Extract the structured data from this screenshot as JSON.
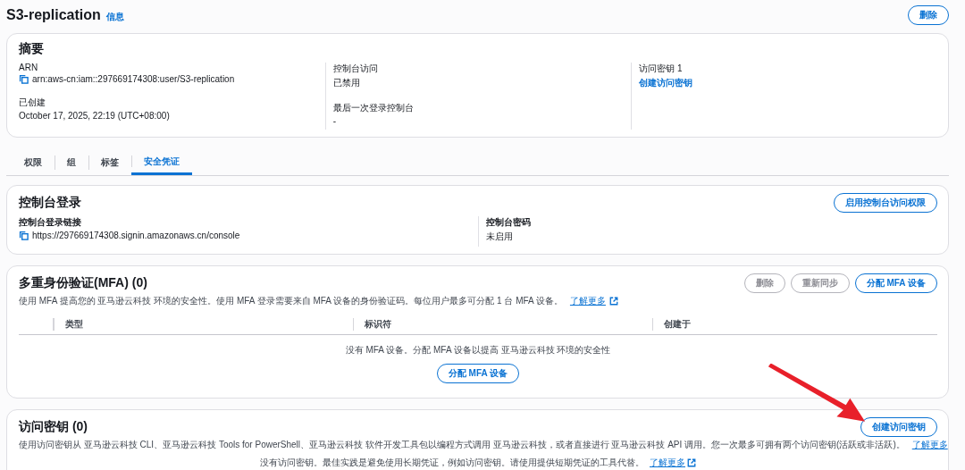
{
  "page": {
    "title": "S3-replication",
    "info_link": "信息",
    "delete_button": "删除"
  },
  "summary": {
    "title": "摘要",
    "columns": [
      [
        {
          "label": "ARN",
          "value": "arn:aws-cn:iam::297669174308:user/S3-replication",
          "kind": "copy"
        },
        {
          "label": "已创建",
          "value": "October 17, 2025, 22:19 (UTC+08:00)",
          "kind": "text"
        }
      ],
      [
        {
          "label": "控制台访问",
          "value": "已禁用",
          "kind": "text"
        },
        {
          "label": "最后一次登录控制台",
          "value": "-",
          "kind": "text"
        }
      ],
      [
        {
          "label": "访问密钥 1",
          "value": "创建访问密钥",
          "kind": "link"
        }
      ]
    ]
  },
  "tabs": [
    {
      "label": "权限",
      "selected": false
    },
    {
      "label": "组",
      "selected": false
    },
    {
      "label": "标签",
      "selected": false
    },
    {
      "label": "安全凭证",
      "selected": true
    }
  ],
  "console_login": {
    "title": "控制台登录",
    "button": "启用控制台访问权限",
    "fields": [
      {
        "label": "控制台登录链接",
        "value": "https://297669174308.signin.amazonaws.cn/console",
        "kind": "copy"
      },
      {
        "label": "控制台密码",
        "value": "未启用",
        "kind": "text"
      }
    ]
  },
  "mfa": {
    "title": "多重身份验证(MFA) (0)",
    "description": "使用 MFA 提高您的 亚马逊云科技 环境的安全性。使用 MFA 登录需要来自 MFA 设备的身份验证码。每位用户最多可分配 1 台 MFA 设备。",
    "learn_more": "了解更多",
    "buttons": [
      {
        "label": "删除",
        "disabled": true
      },
      {
        "label": "重新同步",
        "disabled": true
      },
      {
        "label": "分配 MFA 设备",
        "disabled": false
      }
    ],
    "table": {
      "columns": [
        "类型",
        "标识符",
        "创建于"
      ],
      "empty_text": "没有 MFA 设备。分配 MFA 设备以提高 亚马逊云科技 环境的安全性",
      "empty_button": "分配 MFA 设备"
    }
  },
  "access_keys": {
    "title": "访问密钥 (0)",
    "button": "创建访问密钥",
    "description": "使用访问密钥从 亚马逊云科技 CLI、亚马逊云科技 Tools for PowerShell、亚马逊云科技 软件开发工具包以编程方式调用 亚马逊云科技，或者直接进行 亚马逊云科技 API 调用。您一次最多可拥有两个访问密钥(活跃或非活跃)。",
    "learn_more": "了解更多",
    "empty_text": "没有访问密钥。最佳实践是避免使用长期凭证，例如访问密钥。请使用提供短期凭证的工具代替。",
    "empty_learn_more": "了解更多"
  }
}
